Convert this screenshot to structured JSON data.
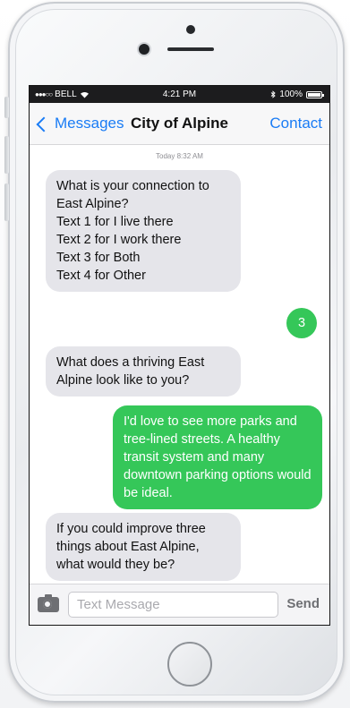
{
  "status_bar": {
    "carrier": "BELL",
    "time": "4:21 PM",
    "battery": "100%"
  },
  "nav": {
    "back_label": "Messages",
    "title": "City of Alpine",
    "contact_label": "Contact"
  },
  "thread": {
    "timestamp": "Today 8:32 AM",
    "messages": [
      {
        "direction": "incoming",
        "text": "What is your connection to East Alpine?\nText 1 for I live there\nText 2 for I work there\nText 3 for Both\nText 4 for Other"
      },
      {
        "direction": "outgoing",
        "text": "3"
      },
      {
        "direction": "incoming",
        "text": "What does a thriving East Alpine look like to you?"
      },
      {
        "direction": "outgoing",
        "text": "I'd love to see more parks and tree-lined streets. A healthy transit system and many downtown parking options would be ideal."
      },
      {
        "direction": "incoming",
        "text": "If you could improve three things about East Alpine, what would they be?"
      }
    ]
  },
  "composer": {
    "placeholder": "Text Message",
    "send_label": "Send"
  },
  "colors": {
    "ios_blue": "#1a7cf5",
    "outgoing_bubble": "#35c759",
    "incoming_bubble": "#e5e5ea"
  }
}
